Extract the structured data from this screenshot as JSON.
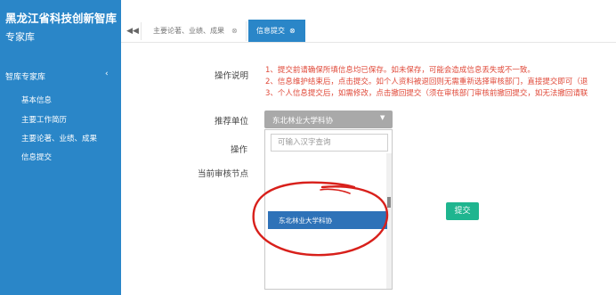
{
  "sidebar": {
    "title": "黑龙江省科技创新智库",
    "subtitle": "专家库",
    "module": {
      "label": "智库专家库",
      "chevron": "‹"
    },
    "items": [
      {
        "label": "基本信息"
      },
      {
        "label": "主要工作简历"
      },
      {
        "label": "主要论著、业绩、成果"
      },
      {
        "label": "信息提交"
      }
    ]
  },
  "tabs": {
    "back_glyph": "◀◀",
    "items": [
      {
        "label": "主要论著、业绩、成果",
        "close": "⊗"
      },
      {
        "label": "信息提交",
        "close": "⊗",
        "active": true
      }
    ]
  },
  "form": {
    "instructions_label": "操作说明",
    "instructions": [
      "1、提交前请确保所填信息均已保存。如未保存，可能会造成信息丢失或不一致。",
      "2、信息维护结束后，点击提交。如个人资料被退回则无需重新选择审核部门，直接提交即可（退",
      "3、个人信息提交后，如需修改，点击撤回提交（须在审核部门审核前撤回提交，如无法撤回请联"
    ],
    "recommend_label": "推荐单位",
    "recommend_value": "东北林业大学科协",
    "operation_label": "操作",
    "current_node_label": "当前审核节点",
    "search_placeholder": "可输入汉字查询",
    "option_label": "东北林业大学科协",
    "submit_label": "提交"
  },
  "colors": {
    "sidebar_bg": "#2a86c8",
    "active_tab": "#2a86c8",
    "instruction_text": "#e04a3a",
    "submit_button": "#1fb58f",
    "selected_option": "#2e72b8",
    "annotation": "#d8201b"
  }
}
